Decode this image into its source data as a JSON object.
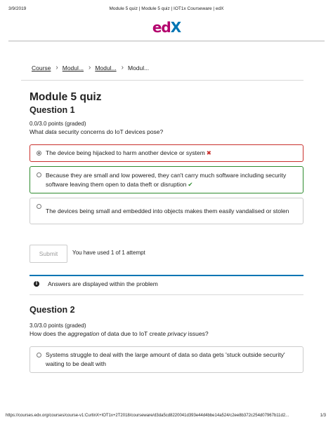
{
  "print_header": {
    "date": "3/9/2019",
    "title": "Module 5 quiz | Module 5 quiz | IOT1x Courseware | edX"
  },
  "logo": {
    "part1": "ed",
    "part2": "X"
  },
  "breadcrumb": {
    "items": [
      "Course",
      "Modul...",
      "Modul...",
      "Modul..."
    ],
    "separator": "›"
  },
  "quiz_title": "Module 5 quiz",
  "questions": [
    {
      "heading": "Question 1",
      "points": "0.0/3.0 points (graded)",
      "prompt_parts": [
        "What ",
        "data",
        " security concerns do IoT devices pose?"
      ],
      "options": [
        {
          "text": "The device being hijacked to harm another device or system",
          "status": "incorrect",
          "selected": true
        },
        {
          "text": "Because they are small and low powered, they can't carry much software including security software leaving them open to data theft or disruption",
          "status": "correct",
          "selected": false
        },
        {
          "text": "The devices being small and embedded into objects makes them easily vandalised or stolen",
          "status": "none",
          "selected": false
        }
      ],
      "submit_label": "Submit",
      "attempts_text": "You have used 1 of 1 attempt",
      "notice": "Answers are displayed within the problem"
    },
    {
      "heading": "Question 2",
      "points": "3.0/3.0 points (graded)",
      "prompt_parts": [
        "How does the ",
        "aggregation",
        " of data due to IoT create ",
        "privacy",
        " issues?"
      ],
      "options": [
        {
          "text": "Systems struggle to deal with the large amount of data so data gets 'stuck outside security' waiting to be dealt with",
          "status": "none",
          "selected": false
        }
      ]
    }
  ],
  "marks": {
    "incorrect": "✖",
    "correct": "✔"
  },
  "icons": {
    "info": "i"
  },
  "print_footer": {
    "url": "https://courses.edx.org/courses/course-v1:CurtinX+IOT1x+2T2018/courseware/d3da5cd8220041d393e44d4bbe14a524/c2ee8b372c254d07967b11d2...",
    "page": "1/3"
  },
  "colors": {
    "edx_magenta": "#b3006d",
    "edx_blue": "#0075b4",
    "incorrect": "#c9302c",
    "correct": "#2e8b2e"
  }
}
